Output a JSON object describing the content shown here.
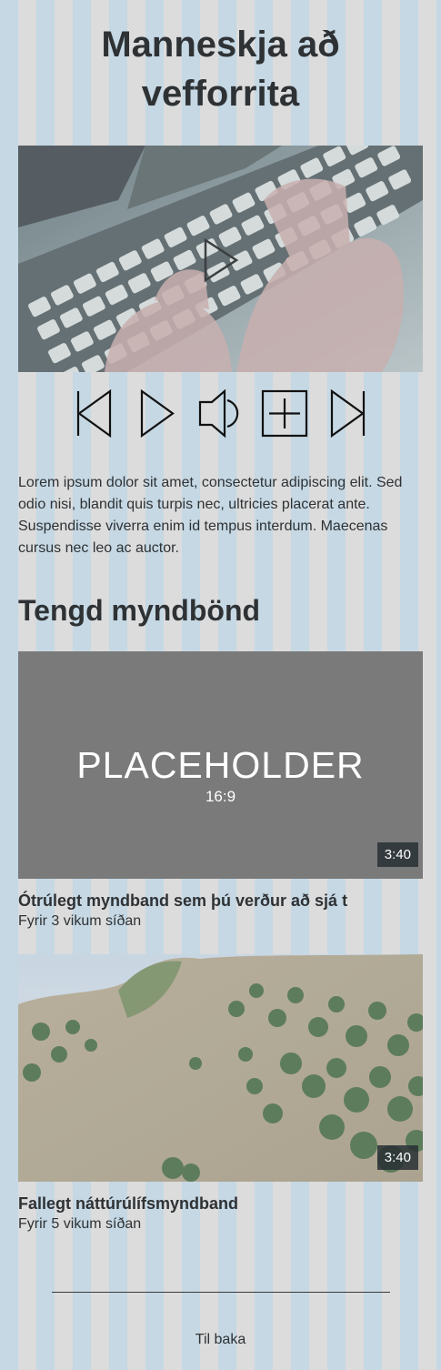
{
  "header": {
    "title": "Manneskja að vefforrita"
  },
  "player": {
    "controls": [
      {
        "name": "back-button",
        "icon": "skip-back-icon"
      },
      {
        "name": "play-button",
        "icon": "play-icon"
      },
      {
        "name": "volume-button",
        "icon": "speaker-icon"
      },
      {
        "name": "fullscreen-button",
        "icon": "fullscreen-icon"
      },
      {
        "name": "forward-button",
        "icon": "skip-forward-icon"
      }
    ]
  },
  "description": "Lorem ipsum dolor sit amet, consectetur adipiscing elit. Sed odio nisi, blandit quis turpis nec, ultricies placerat ante. Suspendisse viverra enim id tempus interdum. Maecenas cursus nec leo ac auctor.",
  "related": {
    "heading": "Tengd myndbönd",
    "videos": [
      {
        "title": "Ótrúlegt myndband sem þú verður að sjá t",
        "meta": "Fyrir 3 vikum síðan",
        "duration": "3:40",
        "placeholder_text": "PLACEHOLDER",
        "placeholder_ratio": "16:9"
      },
      {
        "title": "Fallegt náttúrúlífsmyndband",
        "meta": "Fyrir 5 vikum síðan",
        "duration": "3:40"
      }
    ]
  },
  "footer": {
    "back_label": "Til baka"
  },
  "colors": {
    "stripe_blue": "#c5d8e4",
    "stripe_gray": "#dcdcdc",
    "text": "#2e3235",
    "placeholder_bg": "#7a7a7a"
  }
}
